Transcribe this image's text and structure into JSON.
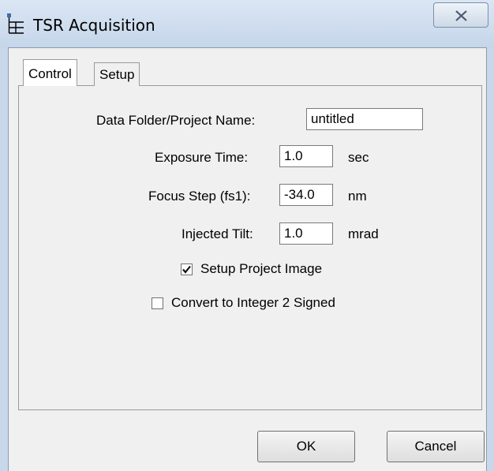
{
  "window": {
    "title": "TSR Acquisition",
    "app_icon": "network-tree-icon",
    "close_icon": "close-icon"
  },
  "tabs": [
    {
      "label": "Control",
      "active": true
    },
    {
      "label": "Setup",
      "active": false
    }
  ],
  "form": {
    "project_name": {
      "label": "Data Folder/Project Name:",
      "value": "untitled"
    },
    "exposure": {
      "label": "Exposure Time:",
      "value": "1.0",
      "unit": "sec"
    },
    "focus_step": {
      "label": "Focus Step (fs1):",
      "value": "-34.0",
      "unit": "nm"
    },
    "tilt": {
      "label": "Injected Tilt:",
      "value": "1.0",
      "unit": "mrad"
    },
    "setup_image": {
      "label": "Setup Project Image",
      "checked": true
    },
    "convert_int": {
      "label": "Convert to Integer 2 Signed",
      "checked": false
    }
  },
  "buttons": {
    "ok": "OK",
    "cancel": "Cancel"
  }
}
